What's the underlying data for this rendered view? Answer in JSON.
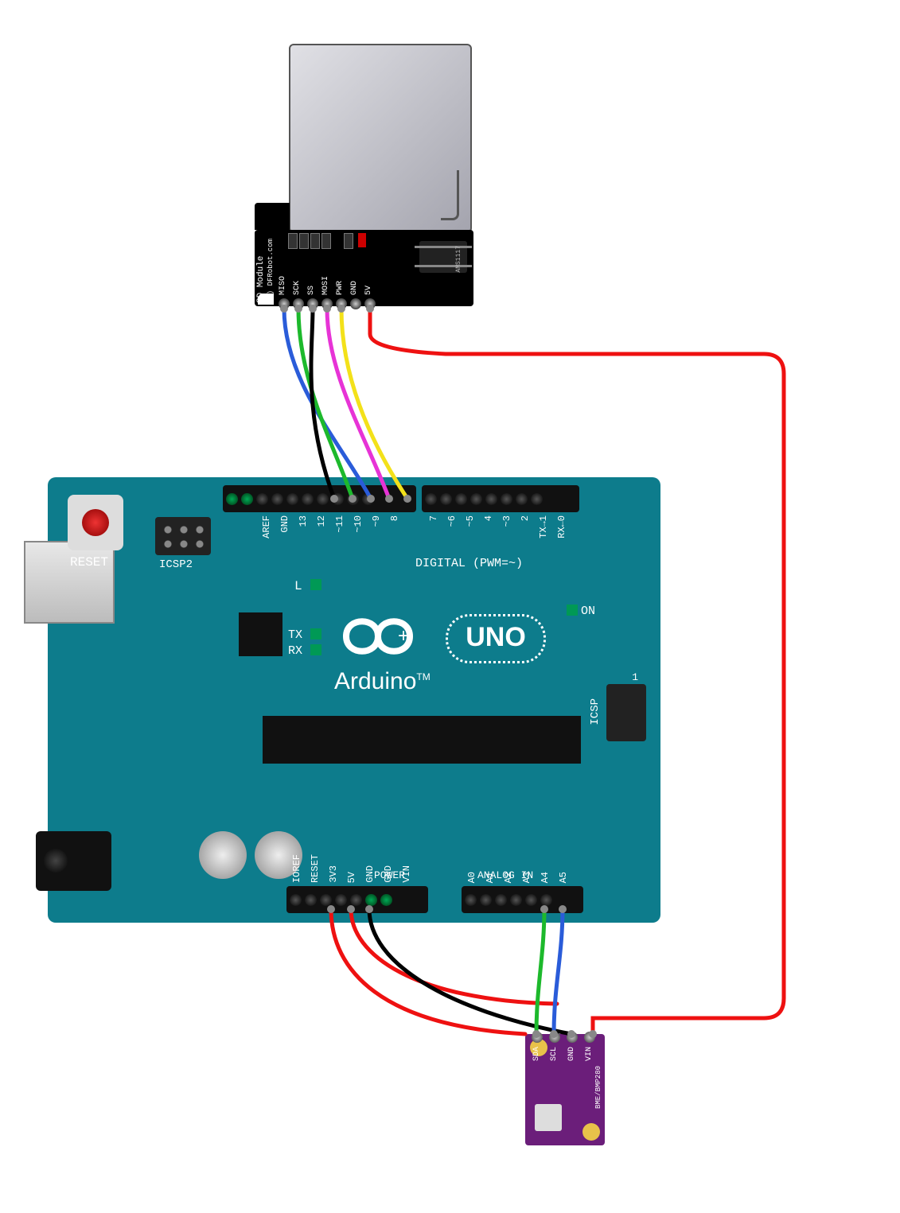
{
  "sd_module": {
    "title": "SD Module",
    "copyright": "(c) DFRobot.com",
    "chip_label": "AMS1117",
    "pins": [
      "MISO",
      "SCK",
      "SS",
      "MOSI",
      "PWR",
      "GND",
      "5V"
    ]
  },
  "arduino": {
    "brand": "Arduino",
    "model": "UNO",
    "reset_label": "RESET",
    "icsp2_label": "ICSP2",
    "icsp_label": "ICSP",
    "icsp_one": "1",
    "on_label": "ON",
    "l_label": "L",
    "tx_label": "TX",
    "rx_label": "RX",
    "digital_label": "DIGITAL (PWM=~)",
    "tx_arrow": "TX→1",
    "rx_arrow": "RX←0",
    "power_label": "POWER",
    "analog_label": "ANALOG IN",
    "top_left_pins": [
      "",
      "",
      "AREF",
      "GND",
      "13",
      "12",
      "~11",
      "~10",
      "~9",
      "8"
    ],
    "top_right_pins": [
      "7",
      "~6",
      "~5",
      "4",
      "~3",
      "2"
    ],
    "power_pins": [
      "IOREF",
      "RESET",
      "3V3",
      "5V",
      "GND",
      "GND",
      "VIN"
    ],
    "analog_pins": [
      "A0",
      "A1",
      "A2",
      "A3",
      "A4",
      "A5"
    ]
  },
  "bme280": {
    "name": "BME/BMP280",
    "pins": [
      "SDA",
      "SCL",
      "GND",
      "VIN"
    ]
  },
  "wires": [
    {
      "name": "sd-miso-to-d12",
      "color": "#2a5cd9",
      "from": "SD.MISO",
      "to": "Arduino.D12"
    },
    {
      "name": "sd-sck-to-d13",
      "color": "#1db92c",
      "from": "SD.SCK",
      "to": "Arduino.D13"
    },
    {
      "name": "sd-ss-to-gnd-top",
      "color": "#000000",
      "from": "SD.SS",
      "to": "Arduino.GND(top)"
    },
    {
      "name": "sd-mosi-to-d11",
      "color": "#e733d6",
      "from": "SD.MOSI",
      "to": "Arduino.D11"
    },
    {
      "name": "sd-pwr-to-d10",
      "color": "#f3e11a",
      "from": "SD.PWR",
      "to": "Arduino.D10"
    },
    {
      "name": "sd-5v-to-bme-vin",
      "color": "#e11",
      "from": "SD.5V",
      "to": "BME.VIN"
    },
    {
      "name": "bme-sda-to-a4",
      "color": "#1db92c",
      "from": "BME.SDA",
      "to": "Arduino.A4"
    },
    {
      "name": "bme-scl-to-a5",
      "color": "#2a5cd9",
      "from": "BME.SCL",
      "to": "Arduino.A5"
    },
    {
      "name": "bme-gnd-to-gnd",
      "color": "#000000",
      "from": "BME.GND",
      "to": "Arduino.GND(power)"
    },
    {
      "name": "arduino-5v-to-sd5v",
      "color": "#e11",
      "from": "Arduino.5V",
      "to": "SD.5V"
    },
    {
      "name": "arduino-3v3-to-bme",
      "color": "#e11",
      "from": "Arduino.3V3",
      "to": "BME.area"
    }
  ]
}
